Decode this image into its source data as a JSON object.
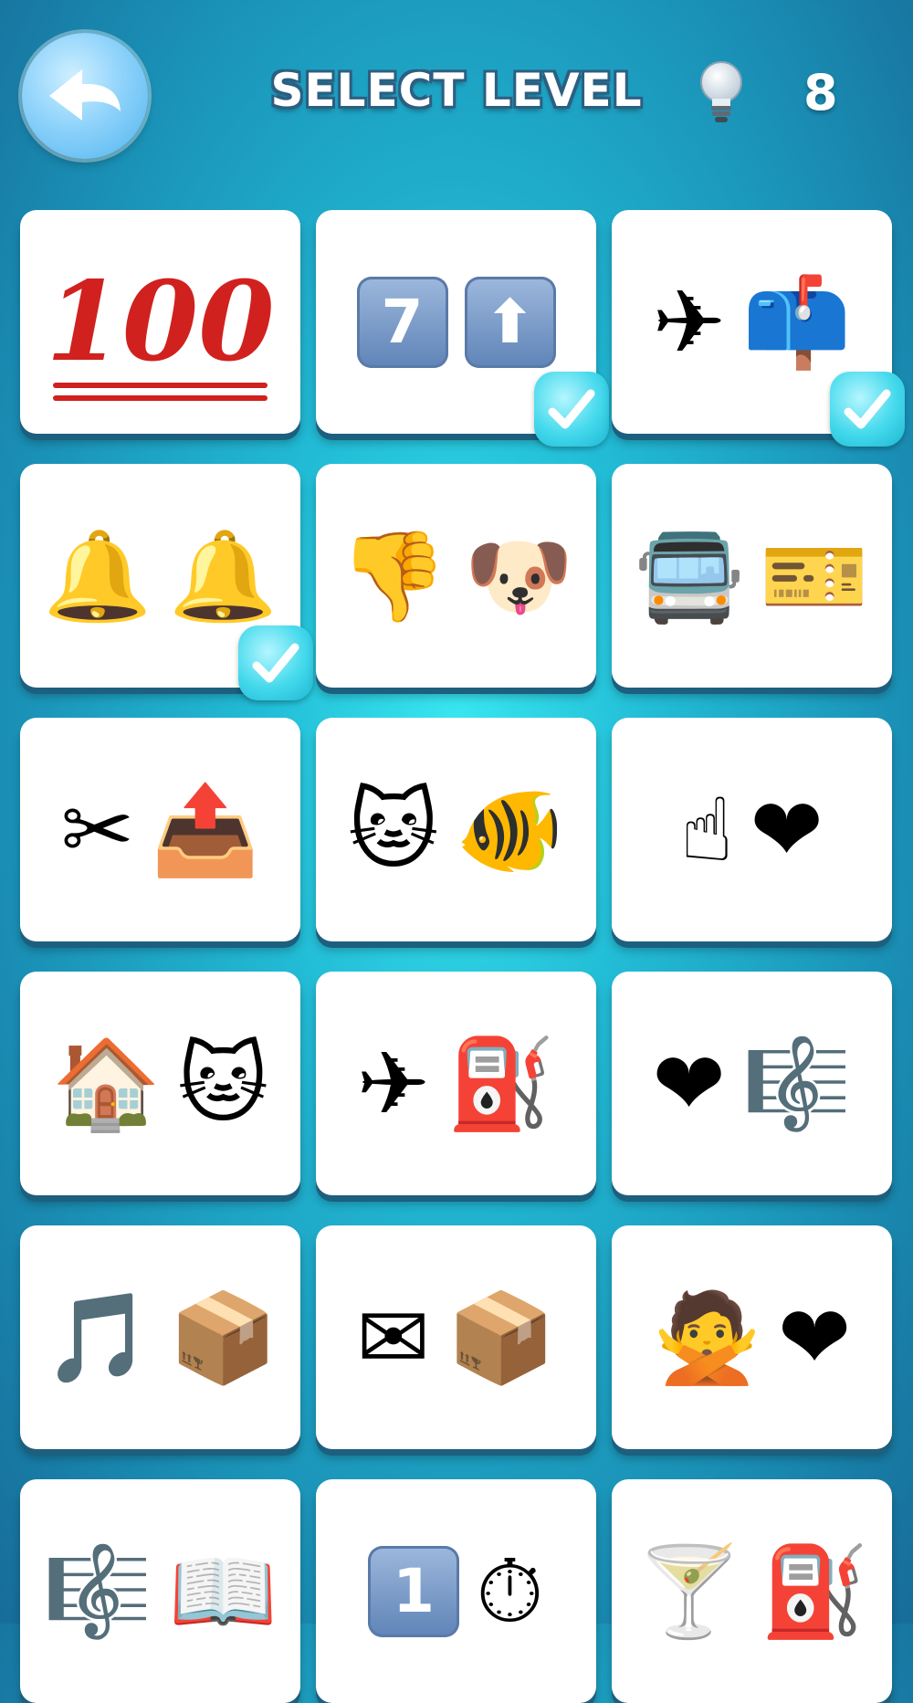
{
  "header": {
    "title": "SELECT LEVEL",
    "hint_count": "8",
    "back_icon": "back-arrow-icon",
    "hint_icon": "lightbulb-icon"
  },
  "colors": {
    "background": "#22bcd6",
    "card": "#ffffff",
    "check_badge": "#44d9ec",
    "title_outline": "#2c5f82"
  },
  "levels": [
    {
      "emojis": [
        "100"
      ],
      "icons": [
        "hundred-points-icon"
      ],
      "completed": false
    },
    {
      "emojis": [
        "7",
        "⬆"
      ],
      "icons": [
        "keycap-seven-icon",
        "up-arrow-icon"
      ],
      "completed": true
    },
    {
      "emojis": [
        "✈",
        "📫"
      ],
      "icons": [
        "airplane-icon",
        "mailbox-icon"
      ],
      "completed": true
    },
    {
      "emojis": [
        "🔔",
        "🔔"
      ],
      "icons": [
        "bell-icon",
        "bell-icon"
      ],
      "completed": true
    },
    {
      "emojis": [
        "👎",
        "🐶"
      ],
      "icons": [
        "thumbs-down-icon",
        "dog-icon"
      ],
      "completed": false
    },
    {
      "emojis": [
        "🚍",
        "🎫"
      ],
      "icons": [
        "bus-icon",
        "ticket-icon"
      ],
      "completed": false
    },
    {
      "emojis": [
        "✂",
        "📤"
      ],
      "icons": [
        "scissors-icon",
        "outbox-tray-icon"
      ],
      "completed": false
    },
    {
      "emojis": [
        "🐱",
        "🐠"
      ],
      "icons": [
        "cat-icon",
        "fish-icon"
      ],
      "completed": false
    },
    {
      "emojis": [
        "☝",
        "❤"
      ],
      "icons": [
        "pointing-up-icon",
        "heart-icon"
      ],
      "completed": false
    },
    {
      "emojis": [
        "🏠",
        "🐱"
      ],
      "icons": [
        "house-icon",
        "cat-icon"
      ],
      "completed": false
    },
    {
      "emojis": [
        "✈",
        "⛽"
      ],
      "icons": [
        "airplane-icon",
        "fuel-pump-icon"
      ],
      "completed": false
    },
    {
      "emojis": [
        "❤",
        "🎼"
      ],
      "icons": [
        "heart-icon",
        "musical-score-icon"
      ],
      "completed": false
    },
    {
      "emojis": [
        "🎵",
        "📦"
      ],
      "icons": [
        "music-note-icon",
        "package-icon"
      ],
      "completed": false
    },
    {
      "emojis": [
        "✉",
        "📦"
      ],
      "icons": [
        "envelope-icon",
        "package-icon"
      ],
      "completed": false
    },
    {
      "emojis": [
        "🙅",
        "❤"
      ],
      "icons": [
        "no-gesture-icon",
        "heart-icon"
      ],
      "completed": false
    },
    {
      "emojis": [
        "🎼",
        "📖"
      ],
      "icons": [
        "musical-score-icon",
        "open-book-icon"
      ],
      "completed": false
    },
    {
      "emojis": [
        "1",
        "⏱"
      ],
      "icons": [
        "keycap-one-icon",
        "stopwatch-icon"
      ],
      "completed": false
    },
    {
      "emojis": [
        "🍸",
        "⛽"
      ],
      "icons": [
        "cocktail-icon",
        "fuel-pump-icon"
      ],
      "completed": false
    }
  ]
}
